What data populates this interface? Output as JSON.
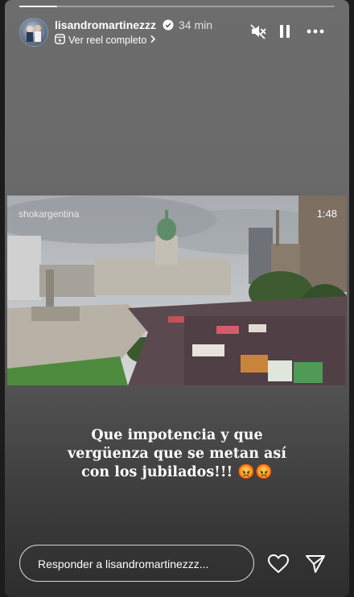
{
  "story": {
    "progress_fraction": 0.12,
    "username": "lisandromartinezzz",
    "time": "34 min",
    "reel_link": "Ver reel completo",
    "media": {
      "watermark": "shokargentina",
      "duration": "1:48"
    },
    "caption_lines": [
      "Que impotencia y que",
      "vergüenza que se metan así",
      "con los jubilados!!! 😡😡"
    ],
    "reply_placeholder": "Responder a lisandromartinezzz...",
    "icons": {
      "verified": "verified-badge-icon",
      "reel": "reel-icon",
      "chevron": "chevron-right-icon",
      "mute": "muted-speaker-icon",
      "pause": "pause-icon",
      "more": "more-options-icon",
      "like": "heart-icon",
      "share": "send-icon"
    }
  }
}
